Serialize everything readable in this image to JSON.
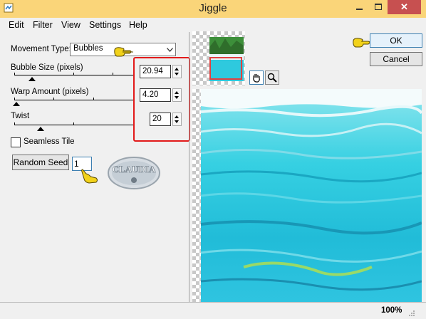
{
  "window": {
    "title": "Jiggle",
    "close_glyph": "✕",
    "minimize_icon": "minimize-icon",
    "maximize_icon": "maximize-icon"
  },
  "menu": [
    "Edit",
    "Filter",
    "View",
    "Settings",
    "Help"
  ],
  "movement_type": {
    "label": "Movement Type:",
    "value": "Bubbles"
  },
  "bubble_size": {
    "label": "Bubble Size (pixels)",
    "value": "20.94"
  },
  "warp_amount": {
    "label": "Warp Amount (pixels)",
    "value": "4.20"
  },
  "twist": {
    "label": "Twist",
    "value": "20"
  },
  "seamless_tile": {
    "label": "Seamless Tile",
    "checked": false
  },
  "random_seed": {
    "label": "Random Seed",
    "value": "1"
  },
  "watermark": {
    "text": "CLAUDIA"
  },
  "buttons": {
    "ok": "OK",
    "cancel": "Cancel"
  },
  "tools": [
    "hand-tool-icon",
    "magnifier-icon"
  ],
  "status": {
    "zoom": "100%"
  },
  "colors": {
    "titlebar": "#fad579",
    "highlight": "#e21a1a",
    "pointer": "#f2d21a",
    "water": "#2ec9de"
  }
}
